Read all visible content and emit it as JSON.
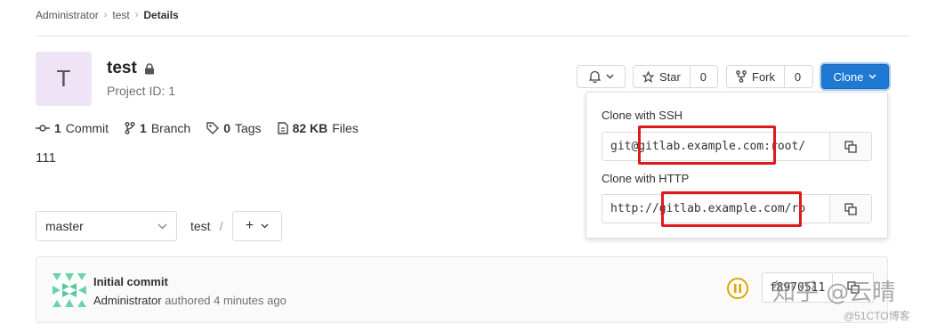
{
  "breadcrumb": {
    "items": [
      "Administrator",
      "test"
    ],
    "current": "Details"
  },
  "project": {
    "avatar_letter": "T",
    "name": "test",
    "id_label": "Project ID: 1",
    "description": "111"
  },
  "stats": {
    "commits_count": "1",
    "commits_label": "Commit",
    "branches_count": "1",
    "branches_label": "Branch",
    "tags_count": "0",
    "tags_label": "Tags",
    "files_size": "82 KB",
    "files_label": "Files"
  },
  "actions": {
    "star_label": "Star",
    "star_count": "0",
    "fork_label": "Fork",
    "fork_count": "0",
    "clone_label": "Clone"
  },
  "clone_dropdown": {
    "ssh_label": "Clone with SSH",
    "ssh_url": "git@gitlab.example.com:root/",
    "http_label": "Clone with HTTP",
    "http_url": "http://gitlab.example.com/ro"
  },
  "repo_nav": {
    "branch": "master",
    "path": "test",
    "separator": "/",
    "add_label": "+"
  },
  "commit": {
    "title": "Initial commit",
    "author": "Administrator",
    "meta": "authored 4 minutes ago",
    "sha": "f8970511"
  },
  "watermark": {
    "line1": "知乎 @云晴",
    "line2": "@51CTO博客"
  },
  "colors": {
    "accent": "#1f78d1",
    "highlight": "#e0191b",
    "pipeline": "#e0a400",
    "avatar_bg": "#eee4f5"
  }
}
